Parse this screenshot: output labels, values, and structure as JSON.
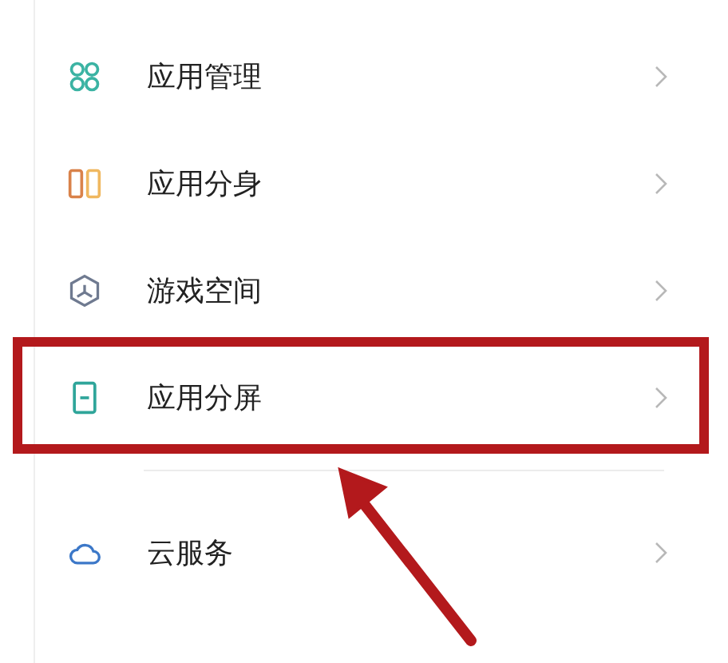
{
  "groups": [
    {
      "items": [
        {
          "label": "应用管理",
          "highlighted": false
        },
        {
          "label": "应用分身",
          "highlighted": false
        },
        {
          "label": "游戏空间",
          "highlighted": false
        },
        {
          "label": "应用分屏",
          "highlighted": true
        }
      ]
    },
    {
      "items": [
        {
          "label": "云服务",
          "highlighted": false
        }
      ]
    }
  ]
}
